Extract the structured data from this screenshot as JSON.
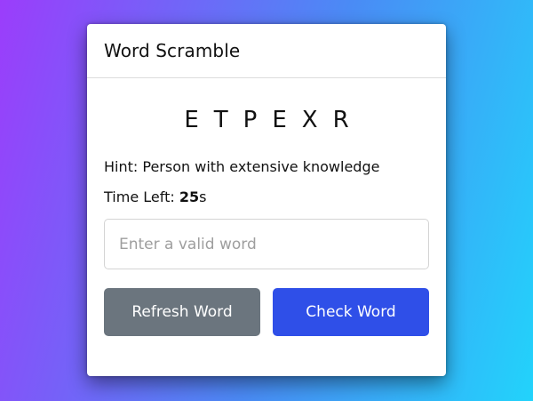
{
  "game": {
    "title": "Word Scramble",
    "scrambled_word": "ETPEXR",
    "hint_label": "Hint:",
    "hint_text": "Person with extensive knowledge",
    "time_label": "Time Left:",
    "time_value": "25",
    "time_unit": "s"
  },
  "input": {
    "placeholder": "Enter a valid word",
    "value": ""
  },
  "buttons": {
    "refresh_label": "Refresh Word",
    "check_label": "Check Word"
  },
  "colors": {
    "refresh_button": "#6b757e",
    "check_button": "#2f4fe8",
    "background_start": "#9b3dfb",
    "background_end": "#22d3fb"
  }
}
